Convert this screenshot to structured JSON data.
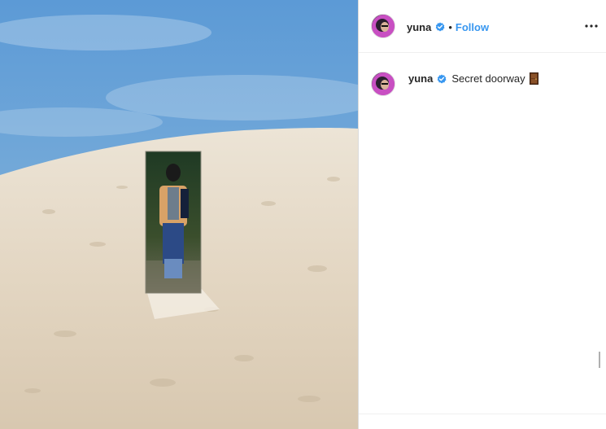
{
  "header": {
    "username": "yuna",
    "separator": "•",
    "follow_label": "Follow"
  },
  "caption": {
    "username": "yuna",
    "text": "Secret doorway",
    "emoji_icon": "door-icon"
  },
  "icons": {
    "verified": "verified-badge-icon",
    "more": "more-options-icon"
  },
  "colors": {
    "accent": "#3897f0",
    "text": "#262626",
    "verified": "#3897f0",
    "border": "#dbdbdb"
  }
}
